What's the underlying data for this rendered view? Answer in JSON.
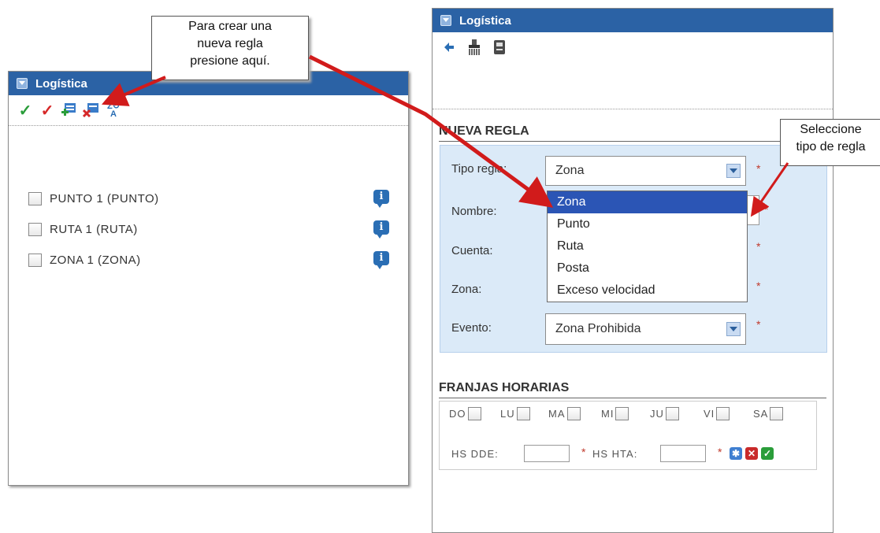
{
  "left_panel": {
    "title": "Logística",
    "toolbar_icons": [
      "check-green-icon",
      "check-red-icon",
      "add-rule-icon",
      "delete-rule-icon",
      "sort-az-icon"
    ],
    "items": [
      {
        "label": "PUNTO 1 (PUNTO)"
      },
      {
        "label": "RUTA 1 (RUTA)"
      },
      {
        "label": "ZONA 1 (ZONA)"
      }
    ]
  },
  "right_panel": {
    "title": "Logística",
    "toolbar_icons": [
      "back-arrow-icon",
      "clear-icon",
      "save-icon"
    ],
    "new_rule": {
      "section_title": "NUEVA REGLA",
      "tipo_label": "Tipo regla:",
      "tipo_value": "Zona",
      "nombre_label": "Nombre:",
      "cuenta_label": "Cuenta:",
      "zona_label": "Zona:",
      "evento_label": "Evento:",
      "evento_value": "Zona Prohibida",
      "required_mark": "*"
    },
    "dropdown_options": [
      "Zona",
      "Punto",
      "Ruta",
      "Posta",
      "Exceso velocidad"
    ],
    "dropdown_selected": "Zona",
    "schedule": {
      "section_title": "FRANJAS HORARIAS",
      "days": [
        "DO",
        "LU",
        "MA",
        "MI",
        "JU",
        "VI",
        "SA"
      ],
      "from_label": "HS DDE:",
      "to_label": "HS HTA:",
      "required_mark": "*"
    }
  },
  "callouts": {
    "new_rule_hint": [
      "Para crear una",
      "nueva regla",
      "presione aquí."
    ],
    "select_type_hint": [
      "Seleccione",
      "tipo de regla"
    ]
  },
  "colors": {
    "titlebar": "#2b62a5",
    "form_bg": "#dbeaf8",
    "arrow": "#d11b1b",
    "selected_option": "#2b55b5"
  }
}
